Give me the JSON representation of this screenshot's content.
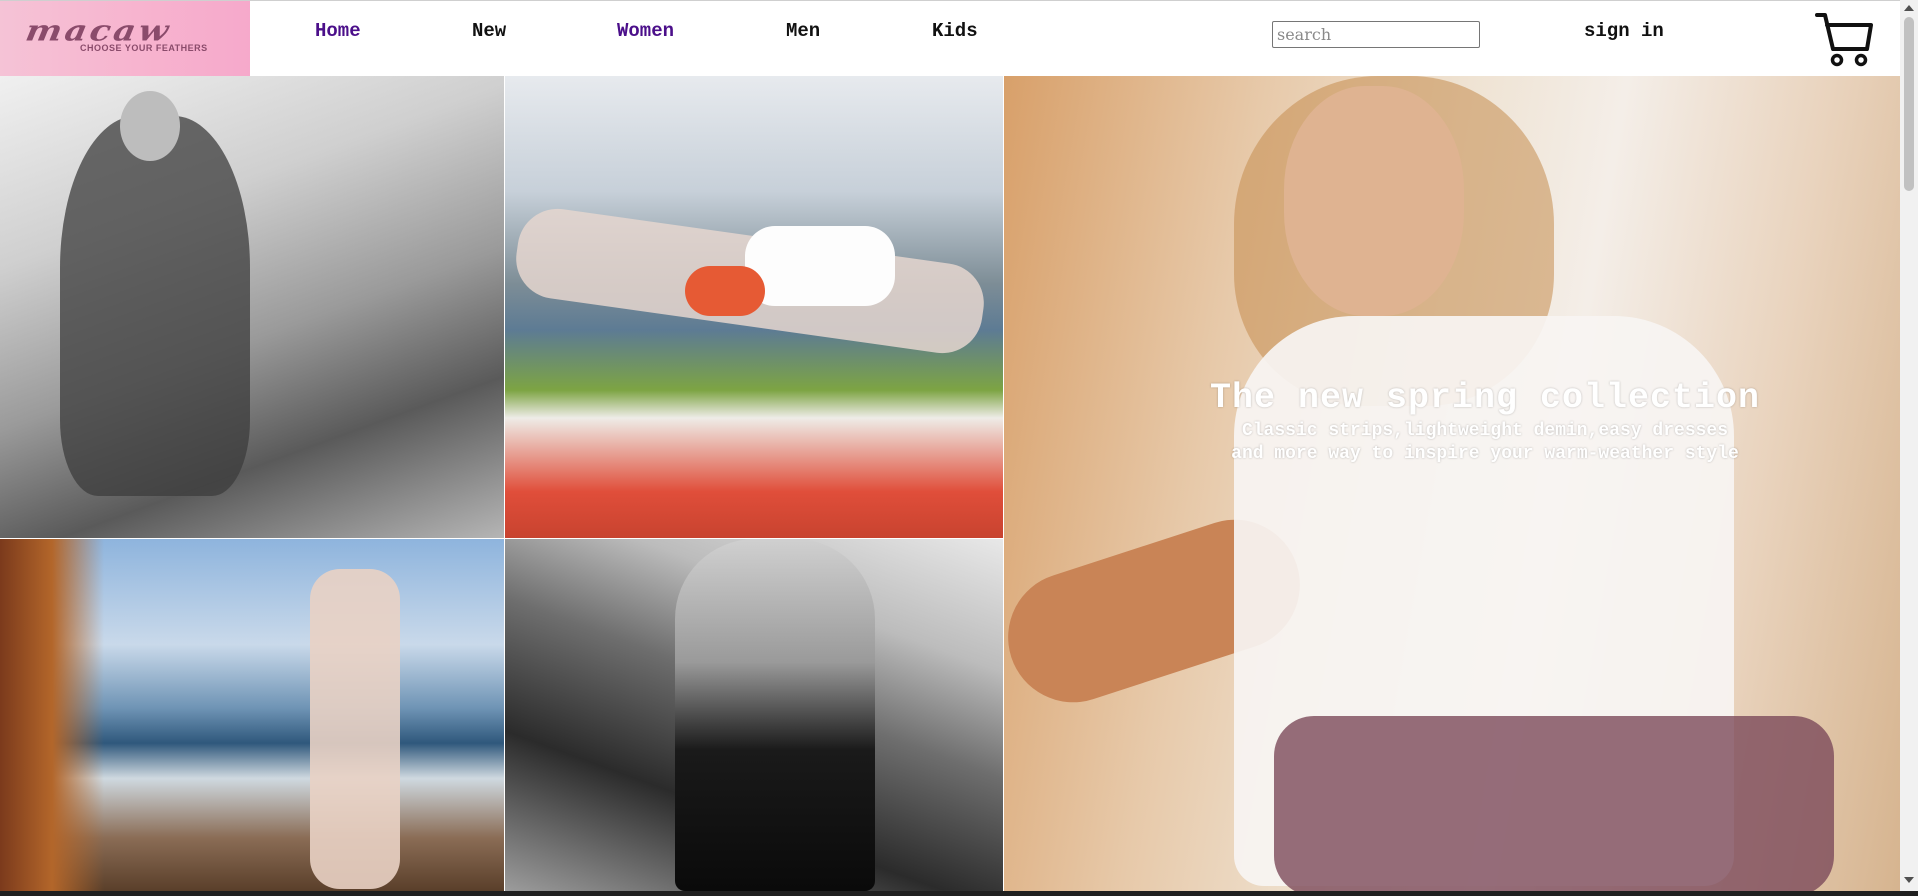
{
  "brand": {
    "logo_text": "macaw",
    "tagline": "CHOOSE YOUR FEATHERS",
    "logo_bg": "#f7b4cf"
  },
  "nav": {
    "items": [
      {
        "label": "Home",
        "state": "visited"
      },
      {
        "label": "New",
        "state": "default"
      },
      {
        "label": "Women",
        "state": "visited"
      },
      {
        "label": "Men",
        "state": "default"
      },
      {
        "label": "Kids",
        "state": "default"
      }
    ],
    "visited_color": "#4b0f8a"
  },
  "search": {
    "placeholder": "search",
    "value": ""
  },
  "account": {
    "signin_label": "sign in"
  },
  "cart": {
    "icon": "shopping-cart-icon"
  },
  "hero": {
    "headline": "The new spring collection",
    "subtext": "Classic strips,lightweight demin,easy dresses\nand more way to inspire your warm-weather style"
  },
  "gallery": [
    {
      "name": "photo-woman-street-bw"
    },
    {
      "name": "photo-woman-on-boat"
    },
    {
      "name": "photo-woman-beach"
    },
    {
      "name": "photo-woman-back-harbor-bw"
    },
    {
      "name": "photo-hero-woman-white-shirt"
    }
  ]
}
